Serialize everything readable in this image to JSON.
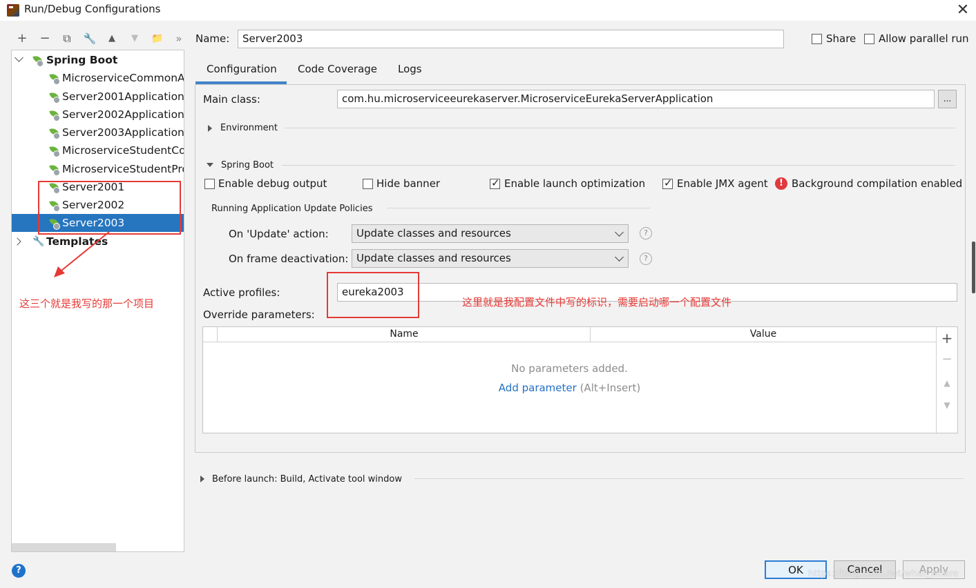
{
  "window": {
    "title": "Run/Debug Configurations",
    "close_glyph": "✕"
  },
  "toolbar": {
    "buttons": [
      {
        "glyph": "+",
        "icon": "add-icon"
      },
      {
        "glyph": "−",
        "icon": "remove-icon"
      },
      {
        "glyph": "⧉",
        "icon": "copy-icon"
      },
      {
        "glyph": "🔧",
        "icon": "wrench-icon"
      },
      {
        "glyph": "▲",
        "icon": "move-up-icon"
      },
      {
        "glyph": "▼",
        "icon": "move-down-icon"
      },
      {
        "glyph": "📁",
        "icon": "folder-add-icon"
      },
      {
        "glyph": "»",
        "icon": "more-icon"
      }
    ]
  },
  "tree": {
    "root_label": "Spring Boot",
    "items": [
      "MicroserviceCommonAp",
      "Server2001Application",
      "Server2002Application",
      "Server2003Application",
      "MicroserviceStudentCo",
      "MicroserviceStudentPro",
      "Server2001",
      "Server2002",
      "Server2003"
    ],
    "selected": "Server2003",
    "templates_label": "Templates"
  },
  "name_row": {
    "label": "Name:",
    "value": "Server2003",
    "share_label": "Share",
    "parallel_label": "Allow parallel run"
  },
  "tabs": [
    "Configuration",
    "Code Coverage",
    "Logs"
  ],
  "config": {
    "main_class_label": "Main class:",
    "main_class_value": "com.hu.microserviceeurekaserver.MicroserviceEurekaServerApplication",
    "browse_label": "...",
    "environment_label": "Environment",
    "spring_boot_label": "Spring Boot",
    "checkboxes": [
      {
        "label": "Enable debug output",
        "checked": false
      },
      {
        "label": "Hide banner",
        "checked": false
      },
      {
        "label": "Enable launch optimization",
        "checked": true
      },
      {
        "label": "Enable JMX agent",
        "checked": true
      }
    ],
    "bg_compilation_label": "Background compilation enabled",
    "policies_label": "Running Application Update Policies",
    "update_action_label": "On 'Update' action:",
    "update_action_value": "Update classes and resources",
    "frame_deactivation_label": "On frame deactivation:",
    "frame_deactivation_value": "Update classes and resources",
    "active_profiles_label": "Active profiles:",
    "active_profiles_value": "eureka2003",
    "override_label": "Override parameters:",
    "table_headers": [
      "Name",
      "Value"
    ],
    "empty_text": "No parameters added.",
    "add_param_link": "Add parameter",
    "add_param_hint": "(Alt+Insert)",
    "table_side_buttons": [
      "+",
      "−",
      "▲",
      "▼"
    ]
  },
  "before_launch_label": "Before launch: Build, Activate tool window",
  "buttons": {
    "ok": "OK",
    "cancel": "Cancel",
    "apply": "Apply",
    "help": "?"
  },
  "annotations": {
    "left_note": "这三个就是我写的那一个项目",
    "right_note": "这里就是我配置文件中写的标识，需要启动哪一个配置文件"
  },
  "watermark": "https://blog.csdn.net/what_where",
  "colors": {
    "selection": "#2675bf",
    "link": "#2470c4",
    "annotation": "#e53935",
    "tab_underline": "#4083c9"
  }
}
